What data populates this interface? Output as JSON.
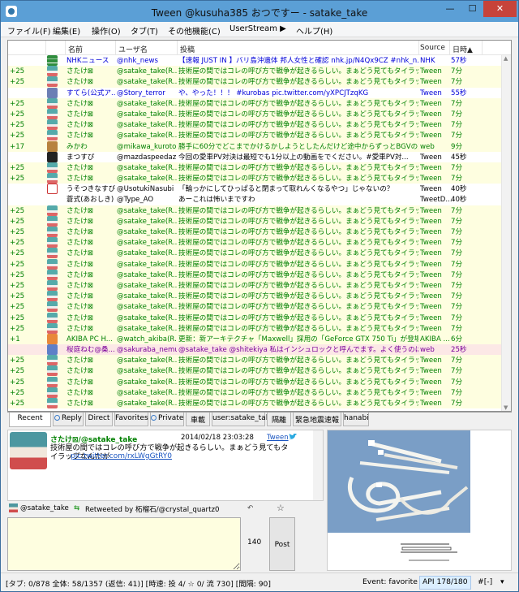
{
  "window": {
    "title": "Tween  @kusuha385 おつですー - satake_take",
    "min_glyph": "—",
    "max_glyph": "☐",
    "close_glyph": "✕"
  },
  "menu": [
    "ファイル(F)",
    "編集(E)",
    "操作(O)",
    "タブ(T)",
    "その他機能(C)",
    "UserStream ▶",
    "ヘルプ(H)"
  ],
  "columns": {
    "name": "名前",
    "user": "ユーザ名",
    "text": "投稿",
    "source": "Source",
    "time": "日時▲"
  },
  "rows": [
    {
      "fav": "",
      "icon": "nhk",
      "name": "NHKニュース",
      "user": "@nhk_news",
      "text": "【速報 JUST IN 】バリ島沖遺体 邦人女性と確認 nhk.jp/N4Qx9CZ #nhk_n...",
      "source": "NHK",
      "time": "57秒",
      "style": "blue"
    },
    {
      "fav": "+25",
      "icon": "teal",
      "name": "さたけ⊠",
      "user": "@satake_take(R...",
      "text": "技術屋の間ではコレの呼び方で戦争が起きるらしい。まぁどう見てもタイラップな",
      "source": "Tween",
      "time": "7分",
      "style": "green"
    },
    {
      "fav": "+25",
      "icon": "teal",
      "name": "さたけ⊠",
      "user": "@satake_take(R...",
      "text": "技術屋の間ではコレの呼び方で戦争が起きるらしい。まぁどう見てもタイラップな",
      "source": "Tween",
      "time": "7分",
      "style": "green"
    },
    {
      "fav": "",
      "icon": "story",
      "name": "すてら(公式ア...",
      "user": "@Story_terror",
      "text": "や、やった！！！ #kurobas pic.twitter.com/yXPCJTzqKG",
      "source": "Tween",
      "time": "55秒",
      "style": "blue"
    },
    {
      "fav": "+25",
      "icon": "teal",
      "name": "さたけ⊠",
      "user": "@satake_take(R...",
      "text": "技術屋の間ではコレの呼び方で戦争が起きるらしい。まぁどう見てもタイラップな",
      "source": "Tween",
      "time": "7分",
      "style": "green"
    },
    {
      "fav": "+25",
      "icon": "teal",
      "name": "さたけ⊠",
      "user": "@satake_take(R...",
      "text": "技術屋の間ではコレの呼び方で戦争が起きるらしい。まぁどう見てもタイラップな",
      "source": "Tween",
      "time": "7分",
      "style": "green"
    },
    {
      "fav": "+25",
      "icon": "teal",
      "name": "さたけ⊠",
      "user": "@satake_take(R...",
      "text": "技術屋の間ではコレの呼び方で戦争が起きるらしい。まぁどう見てもタイラップな",
      "source": "Tween",
      "time": "7分",
      "style": "green"
    },
    {
      "fav": "+25",
      "icon": "teal",
      "name": "さたけ⊠",
      "user": "@satake_take(R...",
      "text": "技術屋の間ではコレの呼び方で戦争が起きるらしい。まぁどう見てもタイラップな",
      "source": "Tween",
      "time": "7分",
      "style": "green"
    },
    {
      "fav": "+17",
      "icon": "mikawa",
      "name": "みかわ",
      "user": "@mikawa_kuroto...",
      "text": "勝手に60分でどこまでかけるかしようとしたんだけど途中からずっとBGVの方に",
      "source": "web",
      "time": "9分",
      "style": "green"
    },
    {
      "fav": "",
      "icon": "mazda",
      "name": "まつすぴ",
      "user": "@mazdaspeedaz1",
      "text": "今回の愛車PV対決は最短でも1分以上の動画をでください。#愛車PV対...",
      "source": "Tween",
      "time": "45秒",
      "style": "white"
    },
    {
      "fav": "+25",
      "icon": "teal",
      "name": "さたけ⊠",
      "user": "@satake_take(R...",
      "text": "技術屋の間ではコレの呼び方で戦争が起きるらしい。まぁどう見てもタイラップな",
      "source": "Tween",
      "time": "7分",
      "style": "green"
    },
    {
      "fav": "+25",
      "icon": "teal",
      "name": "さたけ⊠",
      "user": "@satake_take(R...",
      "text": "技術屋の間ではコレの呼び方で戦争が起きるらしい。まぁどう見てもタイラップな",
      "source": "Tween",
      "time": "7分",
      "style": "green"
    },
    {
      "fav": "",
      "icon": "usotuki",
      "name": "うそつきなすび",
      "user": "@UsotukiNasubi",
      "text": "「輪っかにしてひっぱると閉まって取れんくなるやつ」じゃないの？",
      "source": "Tween",
      "time": "40秒",
      "style": "white"
    },
    {
      "fav": "",
      "icon": "blank",
      "name": "蒼式(あおしき)",
      "user": "@Type_AO",
      "text": "あーこれは怖いまですわ",
      "source": "TweetD...",
      "time": "40秒",
      "style": "white"
    },
    {
      "fav": "+25",
      "icon": "teal",
      "name": "さたけ⊠",
      "user": "@satake_take(R...",
      "text": "技術屋の間ではコレの呼び方で戦争が起きるらしい。まぁどう見てもタイラップな",
      "source": "Tween",
      "time": "7分",
      "style": "green"
    },
    {
      "fav": "+25",
      "icon": "teal",
      "name": "さたけ⊠",
      "user": "@satake_take(R...",
      "text": "技術屋の間ではコレの呼び方で戦争が起きるらしい。まぁどう見てもタイラップな",
      "source": "Tween",
      "time": "7分",
      "style": "green"
    },
    {
      "fav": "+25",
      "icon": "teal",
      "name": "さたけ⊠",
      "user": "@satake_take(R...",
      "text": "技術屋の間ではコレの呼び方で戦争が起きるらしい。まぁどう見てもタイラップな",
      "source": "Tween",
      "time": "7分",
      "style": "green"
    },
    {
      "fav": "+25",
      "icon": "teal",
      "name": "さたけ⊠",
      "user": "@satake_take(R...",
      "text": "技術屋の間ではコレの呼び方で戦争が起きるらしい。まぁどう見てもタイラップな",
      "source": "Tween",
      "time": "7分",
      "style": "green"
    },
    {
      "fav": "+25",
      "icon": "teal",
      "name": "さたけ⊠",
      "user": "@satake_take(R...",
      "text": "技術屋の間ではコレの呼び方で戦争が起きるらしい。まぁどう見てもタイラップな",
      "source": "Tween",
      "time": "7分",
      "style": "green"
    },
    {
      "fav": "+25",
      "icon": "teal",
      "name": "さたけ⊠",
      "user": "@satake_take(R...",
      "text": "技術屋の間ではコレの呼び方で戦争が起きるらしい。まぁどう見てもタイラップな",
      "source": "Tween",
      "time": "7分",
      "style": "green"
    },
    {
      "fav": "+25",
      "icon": "teal",
      "name": "さたけ⊠",
      "user": "@satake_take(R...",
      "text": "技術屋の間ではコレの呼び方で戦争が起きるらしい。まぁどう見てもタイラップな",
      "source": "Tween",
      "time": "7分",
      "style": "green"
    },
    {
      "fav": "+25",
      "icon": "teal",
      "name": "さたけ⊠",
      "user": "@satake_take(R...",
      "text": "技術屋の間ではコレの呼び方で戦争が起きるらしい。まぁどう見てもタイラップな",
      "source": "Tween",
      "time": "7分",
      "style": "green"
    },
    {
      "fav": "+25",
      "icon": "teal",
      "name": "さたけ⊠",
      "user": "@satake_take(R...",
      "text": "技術屋の間ではコレの呼び方で戦争が起きるらしい。まぁどう見てもタイラップな",
      "source": "Tween",
      "time": "7分",
      "style": "green"
    },
    {
      "fav": "+25",
      "icon": "teal",
      "name": "さたけ⊠",
      "user": "@satake_take(R...",
      "text": "技術屋の間ではコレの呼び方で戦争が起きるらしい。まぁどう見てもタイラップな",
      "source": "Tween",
      "time": "7分",
      "style": "green"
    },
    {
      "fav": "+25",
      "icon": "teal",
      "name": "さたけ⊠",
      "user": "@satake_take(R...",
      "text": "技術屋の間ではコレの呼び方で戦争が起きるらしい。まぁどう見てもタイラップな",
      "source": "Tween",
      "time": "7分",
      "style": "green"
    },
    {
      "fav": "+25",
      "icon": "teal",
      "name": "さたけ⊠",
      "user": "@satake_take(R...",
      "text": "技術屋の間ではコレの呼び方で戦争が起きるらしい。まぁどう見てもタイラップな",
      "source": "Tween",
      "time": "7分",
      "style": "green"
    },
    {
      "fav": "+1",
      "icon": "akiba",
      "name": "AKIBA PC H...",
      "user": "@watch_akiba(R...",
      "text": "更新：新アーキテクチャ「Maxwell」採用の「GeForce GTX 750 Ti」が登場、消...",
      "source": "AKIBA ...",
      "time": "6分",
      "style": "green"
    },
    {
      "fav": "",
      "icon": "sakura",
      "name": "桜庭ねむ@桑...",
      "user": "@sakuraba_nemu",
      "text": "@satake_take @shitekiya 私はインシュロックと呼んでます。よく使うのは黒の耐...",
      "source": "web",
      "time": "25秒",
      "style": "sel"
    },
    {
      "fav": "+25",
      "icon": "teal",
      "name": "さたけ⊠",
      "user": "@satake_take(R...",
      "text": "技術屋の間ではコレの呼び方で戦争が起きるらしい。まぁどう見てもタイラップな",
      "source": "Tween",
      "time": "7分",
      "style": "green"
    },
    {
      "fav": "+25",
      "icon": "teal",
      "name": "さたけ⊠",
      "user": "@satake_take(R...",
      "text": "技術屋の間ではコレの呼び方で戦争が起きるらしい。まぁどう見てもタイラップな",
      "source": "Tween",
      "time": "7分",
      "style": "green"
    },
    {
      "fav": "+25",
      "icon": "teal",
      "name": "さたけ⊠",
      "user": "@satake_take(R...",
      "text": "技術屋の間ではコレの呼び方で戦争が起きるらしい。まぁどう見てもタイラップな",
      "source": "Tween",
      "time": "7分",
      "style": "green"
    },
    {
      "fav": "+25",
      "icon": "teal",
      "name": "さたけ⊠",
      "user": "@satake_take(R...",
      "text": "技術屋の間ではコレの呼び方で戦争が起きるらしい。まぁどう見てもタイラップな",
      "source": "Tween",
      "time": "7分",
      "style": "green"
    },
    {
      "fav": "+25",
      "icon": "teal",
      "name": "さたけ⊠",
      "user": "@satake_take(R...",
      "text": "技術屋の間ではコレの呼び方で戦争が起きるらしい。まぁどう見てもタイラップな",
      "source": "Tween",
      "time": "7分",
      "style": "green"
    }
  ],
  "tabs": [
    {
      "label": "Recent",
      "icon": false
    },
    {
      "label": "Reply",
      "icon": true
    },
    {
      "label": "Direct",
      "icon": false
    },
    {
      "label": "Favorites",
      "icon": false
    },
    {
      "label": "Private",
      "icon": true
    },
    {
      "label": "車載",
      "icon": false
    },
    {
      "label": "user:satake_take",
      "icon": false
    },
    {
      "label": "隔離",
      "icon": false
    },
    {
      "label": "緊急地震速報",
      "icon": false
    },
    {
      "label": "hanabi",
      "icon": false
    }
  ],
  "detail": {
    "name": "さたけ⊠/@satake_take",
    "date": "2014/02/18 23:03:28",
    "source": "Tween",
    "text": "技術屋の間ではコレの呼び方で戦争が起きるらしい。まぁどう見てもタイラップなんだが",
    "link": "pic.twitter.com/rxLWgGtRY0"
  },
  "retweet": {
    "user": "@satake_take",
    "label": "Retweeted by 柘榴石/@crystal_quartz0",
    "reply_glyph": "↶",
    "fav_glyph": "☆"
  },
  "compose": {
    "counter": "140",
    "post_label": "Post"
  },
  "status": {
    "main": "[タブ: 0/878 全体: 58/1357 (返信: 41)] [時速: 投 4/ ☆ 0/ 流 730] [間隔: 90]",
    "event": "Event: favorite",
    "api": "API 178/180",
    "hash": "#[-]",
    "dropdown": "▾"
  }
}
